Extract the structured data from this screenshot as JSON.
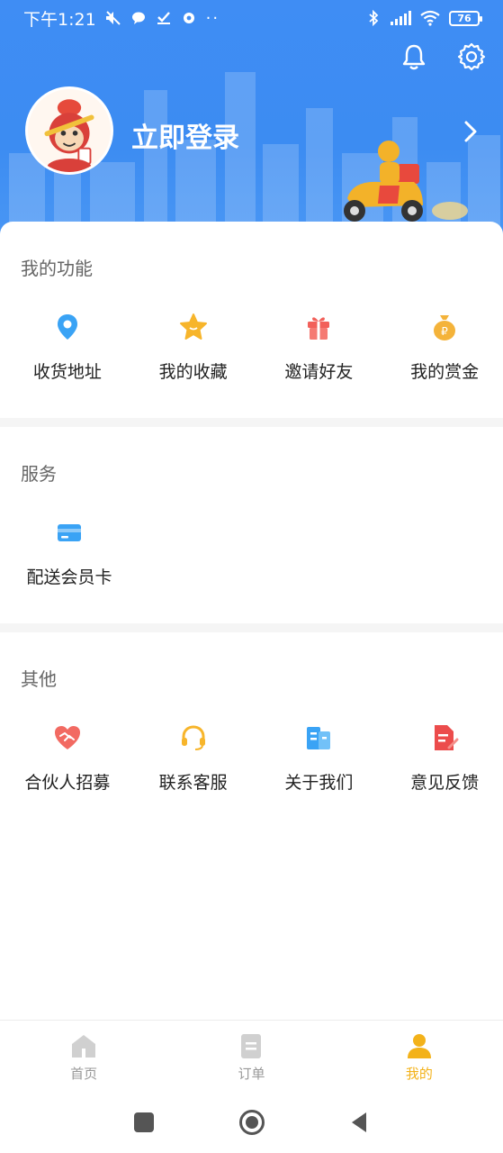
{
  "status_bar": {
    "time": "下午1:21",
    "battery": "76"
  },
  "header": {
    "login_label": "立即登录",
    "icons": [
      "bell-icon",
      "settings-icon",
      "chevron-right-icon"
    ]
  },
  "sections": [
    {
      "title": "我的功能",
      "items": [
        {
          "label": "收货地址",
          "icon": "location-pin-icon",
          "color": "#3aa3f5"
        },
        {
          "label": "我的收藏",
          "icon": "star-icon",
          "color": "#f7b52b"
        },
        {
          "label": "邀请好友",
          "icon": "gift-icon",
          "color": "#f2605a"
        },
        {
          "label": "我的赏金",
          "icon": "money-bag-icon",
          "color": "#f4b33a"
        }
      ]
    },
    {
      "title": "服务",
      "items": [
        {
          "label": "配送会员卡",
          "icon": "card-icon",
          "color": "#3aa3f5"
        }
      ]
    },
    {
      "title": "其他",
      "items": [
        {
          "label": "合伙人招募",
          "icon": "handshake-heart-icon",
          "color": "#f26a62"
        },
        {
          "label": "联系客服",
          "icon": "headset-icon",
          "color": "#f7b52b"
        },
        {
          "label": "关于我们",
          "icon": "building-icon",
          "color": "#3aa3f5"
        },
        {
          "label": "意见反馈",
          "icon": "feedback-doc-icon",
          "color": "#ec4c4c"
        }
      ]
    }
  ],
  "tabbar": {
    "tabs": [
      {
        "label": "首页",
        "icon": "home-icon",
        "active": false
      },
      {
        "label": "订单",
        "icon": "order-icon",
        "active": false
      },
      {
        "label": "我的",
        "icon": "user-icon",
        "active": true
      }
    ],
    "active_color": "#f3b21a",
    "inactive_color": "#999999"
  },
  "colors": {
    "header_blue": "#3f8df4",
    "accent_yellow": "#f3b21a"
  }
}
